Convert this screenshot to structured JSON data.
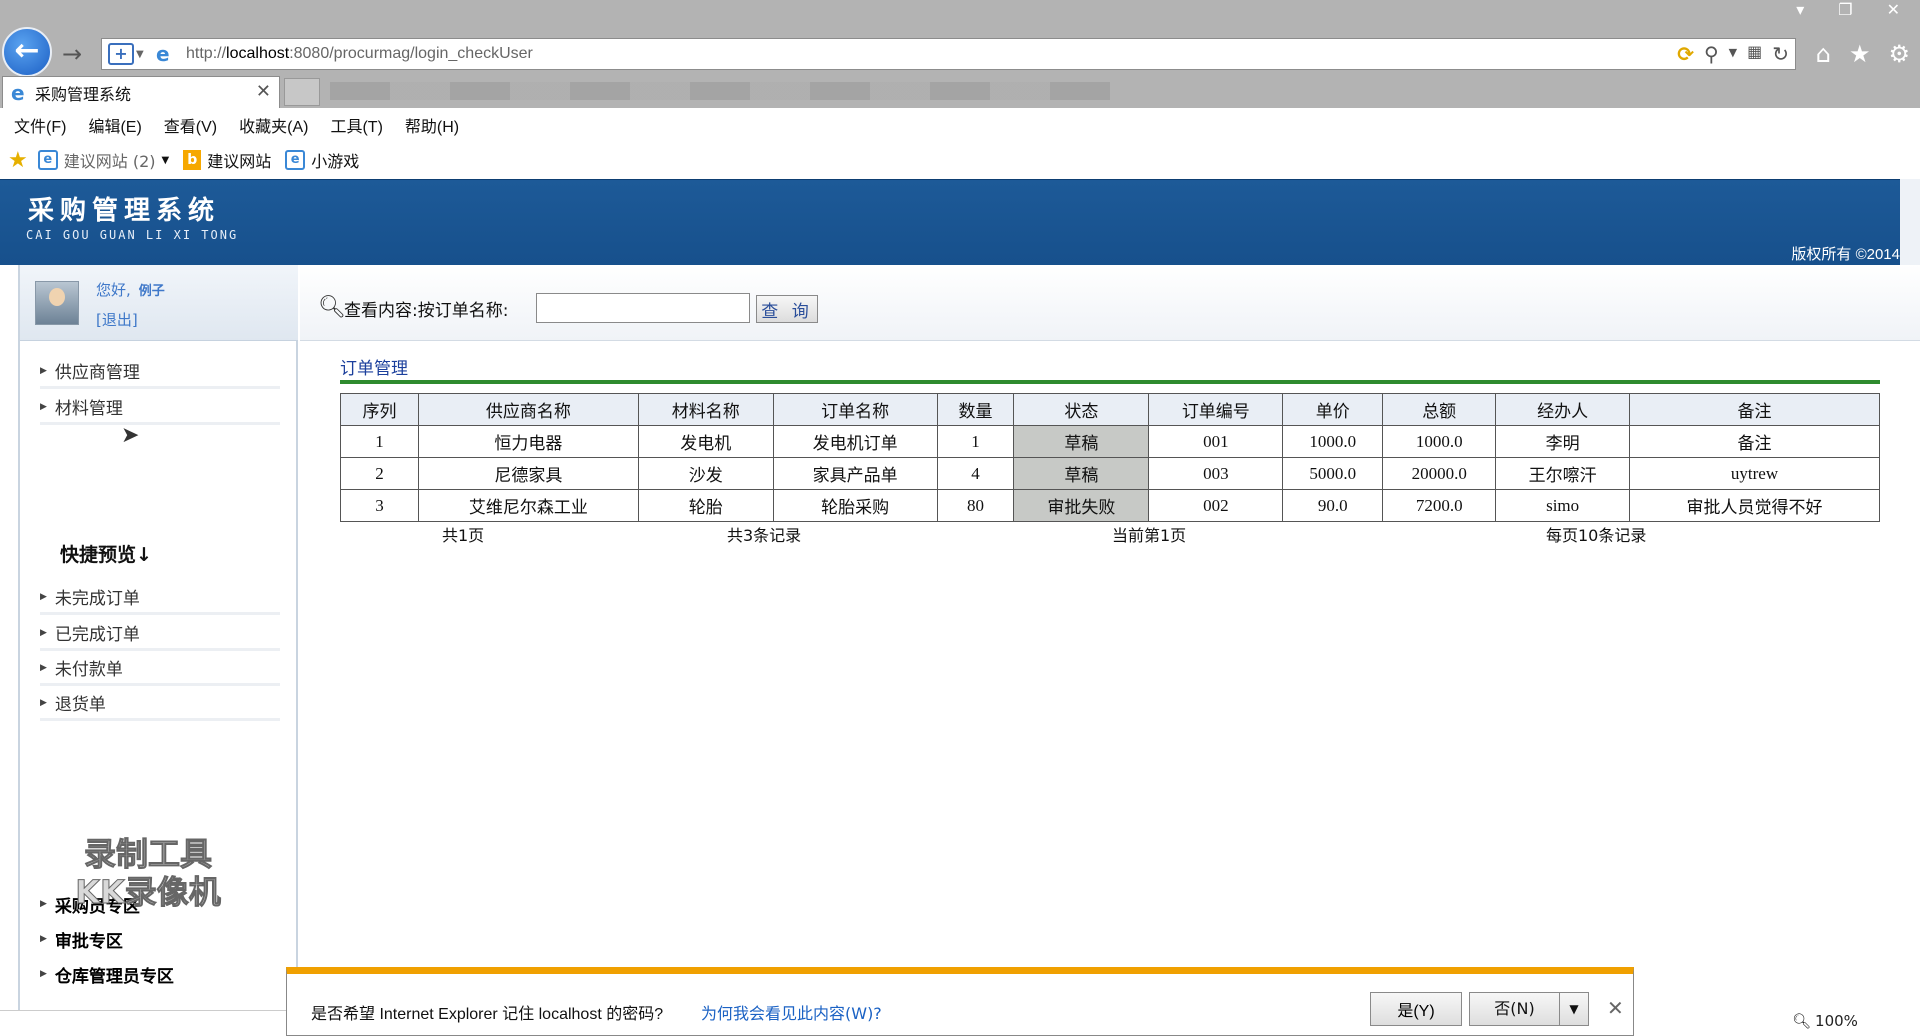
{
  "browser": {
    "url_prefix": "http://",
    "url_host": "localhost",
    "url_rest": ":8080/procurmag/login_checkUser",
    "tab_title": "采购管理系统",
    "menu": [
      "文件(F)",
      "编辑(E)",
      "查看(V)",
      "收藏夹(A)",
      "工具(T)",
      "帮助(H)"
    ],
    "favorites": [
      {
        "label": "建议网站 (2)",
        "has_dropdown": true
      },
      {
        "label": "建议网站",
        "icon": "bing-icon"
      },
      {
        "label": "小游戏"
      }
    ],
    "zoom": "100%"
  },
  "banner": {
    "title": "采购管理系统",
    "subtitle": "CAI GOU GUAN LI XI TONG",
    "copyright": "版权所有  ©2014"
  },
  "user": {
    "greeting": "您好,",
    "name": "例子",
    "logout": "[退出]"
  },
  "sidebar": {
    "items": [
      "供应商管理",
      "材料管理"
    ],
    "quick_title": "快捷预览↓",
    "quick_items": [
      "未完成订单",
      "已完成订单",
      "未付款单",
      "退货单"
    ],
    "zones": [
      "采购员专区",
      "审批专区",
      "仓库管理员专区"
    ]
  },
  "watermark": {
    "line1": "录制工具",
    "line2": "KK录像机"
  },
  "search": {
    "label": "查看内容:按订单名称:",
    "value": "",
    "button": "查 询"
  },
  "section": {
    "title": "订单管理"
  },
  "table": {
    "headers": [
      "序列",
      "供应商名称",
      "材料名称",
      "订单名称",
      "数量",
      "状态",
      "订单编号",
      "单价",
      "总额",
      "经办人",
      "备注"
    ],
    "rows": [
      [
        "1",
        "恒力电器",
        "发电机",
        "发电机订单",
        "1",
        "草稿",
        "001",
        "1000.0",
        "1000.0",
        "李明",
        "备注"
      ],
      [
        "2",
        "尼德家具",
        "沙发",
        "家具产品单",
        "4",
        "草稿",
        "003",
        "5000.0",
        "20000.0",
        "王尔嚓汗",
        "uytrew"
      ],
      [
        "3",
        "艾维尼尔森工业",
        "轮胎",
        "轮胎采购",
        "80",
        "审批失败",
        "002",
        "90.0",
        "7200.0",
        "simo",
        "审批人员觉得不好"
      ]
    ]
  },
  "pager": {
    "total_pages": "共1页",
    "total_records": "共3条记录",
    "current_page": "当前第1页",
    "per_page": "每页10条记录"
  },
  "notification": {
    "message": "是否希望 Internet Explorer 记住 localhost 的密码?",
    "link": "为何我会看见此内容(W)?",
    "yes": "是(Y)",
    "no": "否(N)"
  }
}
